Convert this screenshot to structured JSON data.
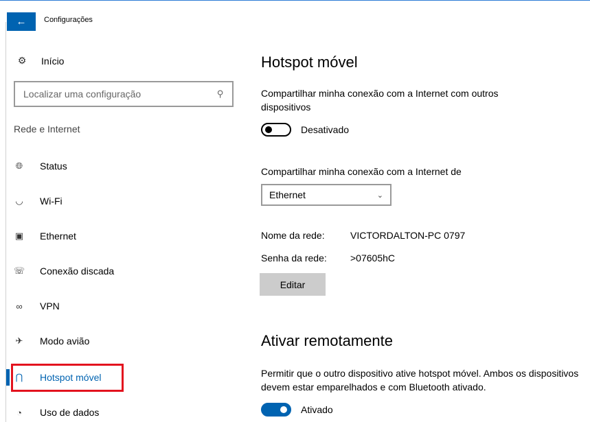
{
  "window": {
    "title": "Configurações"
  },
  "sidebar": {
    "home_label": "Início",
    "search_placeholder": "Localizar uma configuração",
    "section_label": "Rede e Internet",
    "items": [
      {
        "label": "Status",
        "icon": "globe-icon"
      },
      {
        "label": "Wi-Fi",
        "icon": "wifi-icon"
      },
      {
        "label": "Ethernet",
        "icon": "ethernet-icon"
      },
      {
        "label": "Conexão discada",
        "icon": "dialup-icon"
      },
      {
        "label": "VPN",
        "icon": "vpn-icon"
      },
      {
        "label": "Modo avião",
        "icon": "airplane-icon"
      },
      {
        "label": "Hotspot móvel",
        "icon": "hotspot-icon",
        "active": true
      },
      {
        "label": "Uso de dados",
        "icon": "data-usage-icon"
      }
    ]
  },
  "main": {
    "title": "Hotspot móvel",
    "share_description": "Compartilhar minha conexão com a Internet com outros dispositivos",
    "share_toggle_state": "Desativado",
    "share_from_label": "Compartilhar minha conexão com a Internet de",
    "share_from_value": "Ethernet",
    "network_name_label": "Nome da rede:",
    "network_name_value": "VICTORDALTON-PC 0797",
    "network_password_label": "Senha da rede:",
    "network_password_value": ">07605hC",
    "edit_button": "Editar",
    "remote_title": "Ativar remotamente",
    "remote_description": "Permitir que o outro dispositivo ative hotspot móvel. Ambos os dispositivos devem estar emparelhados e com Bluetooth ativado.",
    "remote_toggle_state": "Ativado"
  },
  "colors": {
    "accent": "#0063b1",
    "highlight": "#e3131e"
  }
}
